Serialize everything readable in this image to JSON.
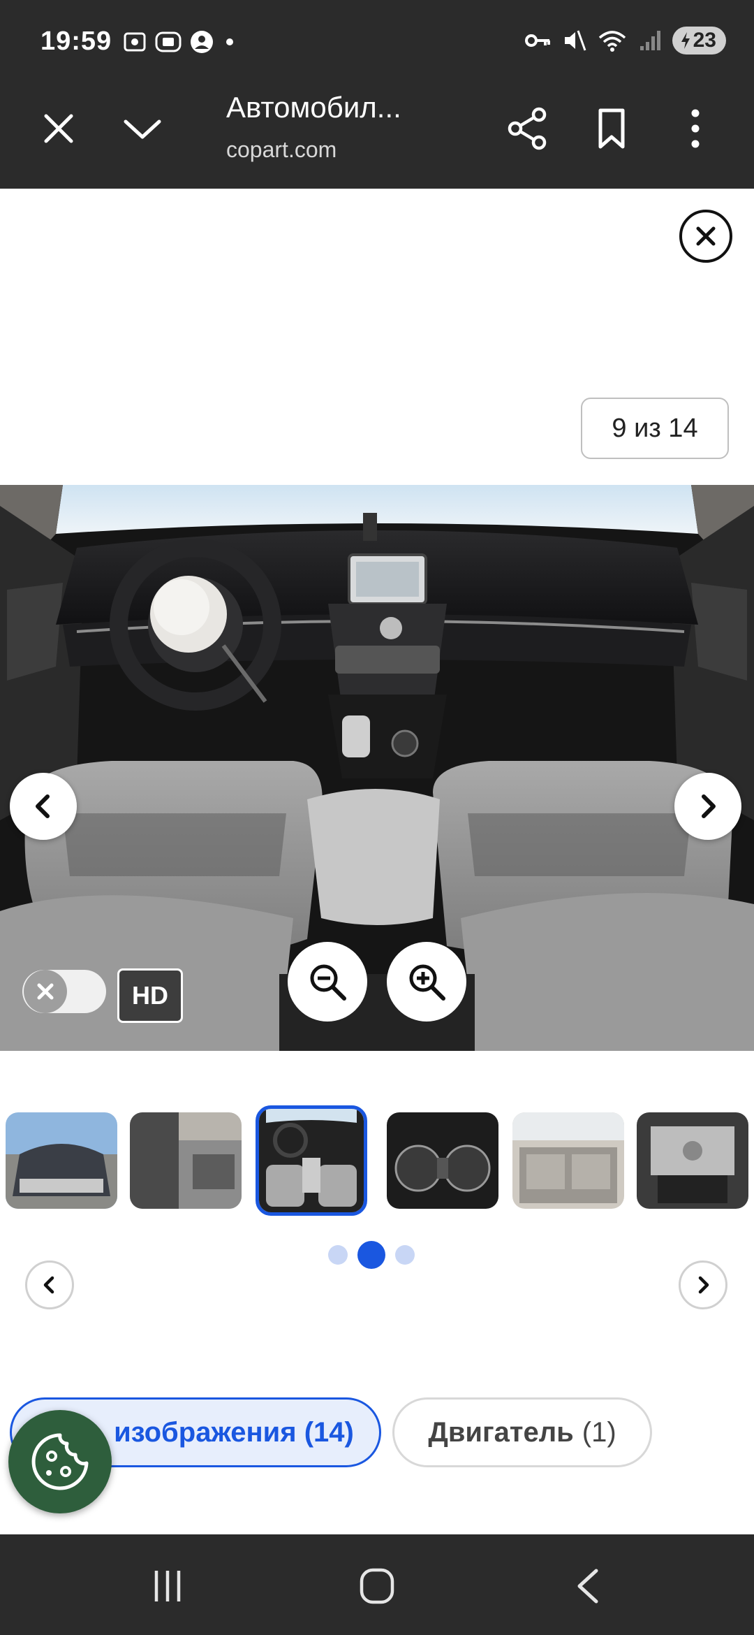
{
  "status_bar": {
    "time": "19:59",
    "battery": "23",
    "icons_left": [
      "screenshot-icon",
      "cast-icon",
      "account-icon",
      "dot-icon"
    ],
    "icons_right": [
      "key-icon",
      "mute-icon",
      "wifi-icon",
      "signal-icon",
      "battery-charging-icon"
    ]
  },
  "toolbar": {
    "title": "Автомобил...",
    "domain": "copart.com",
    "icons": [
      "close-icon",
      "chevron-down-icon",
      "share-icon",
      "bookmark-icon",
      "more-vert-icon"
    ]
  },
  "gallery": {
    "counter": "9 из 14",
    "hd_label": "HD",
    "hd_toggle_on": false,
    "thumbnails_count": 6,
    "active_thumbnail_index": 2,
    "pagination_dots": 3,
    "active_dot_index": 1
  },
  "tabs": [
    {
      "label": "изображения (14)",
      "active": true
    },
    {
      "label": "Двигатель",
      "count": "(1)",
      "active": false
    }
  ],
  "colors": {
    "accent": "#1a57e0",
    "chrome": "#2b2b2b",
    "cookie": "#2e5e3c"
  }
}
